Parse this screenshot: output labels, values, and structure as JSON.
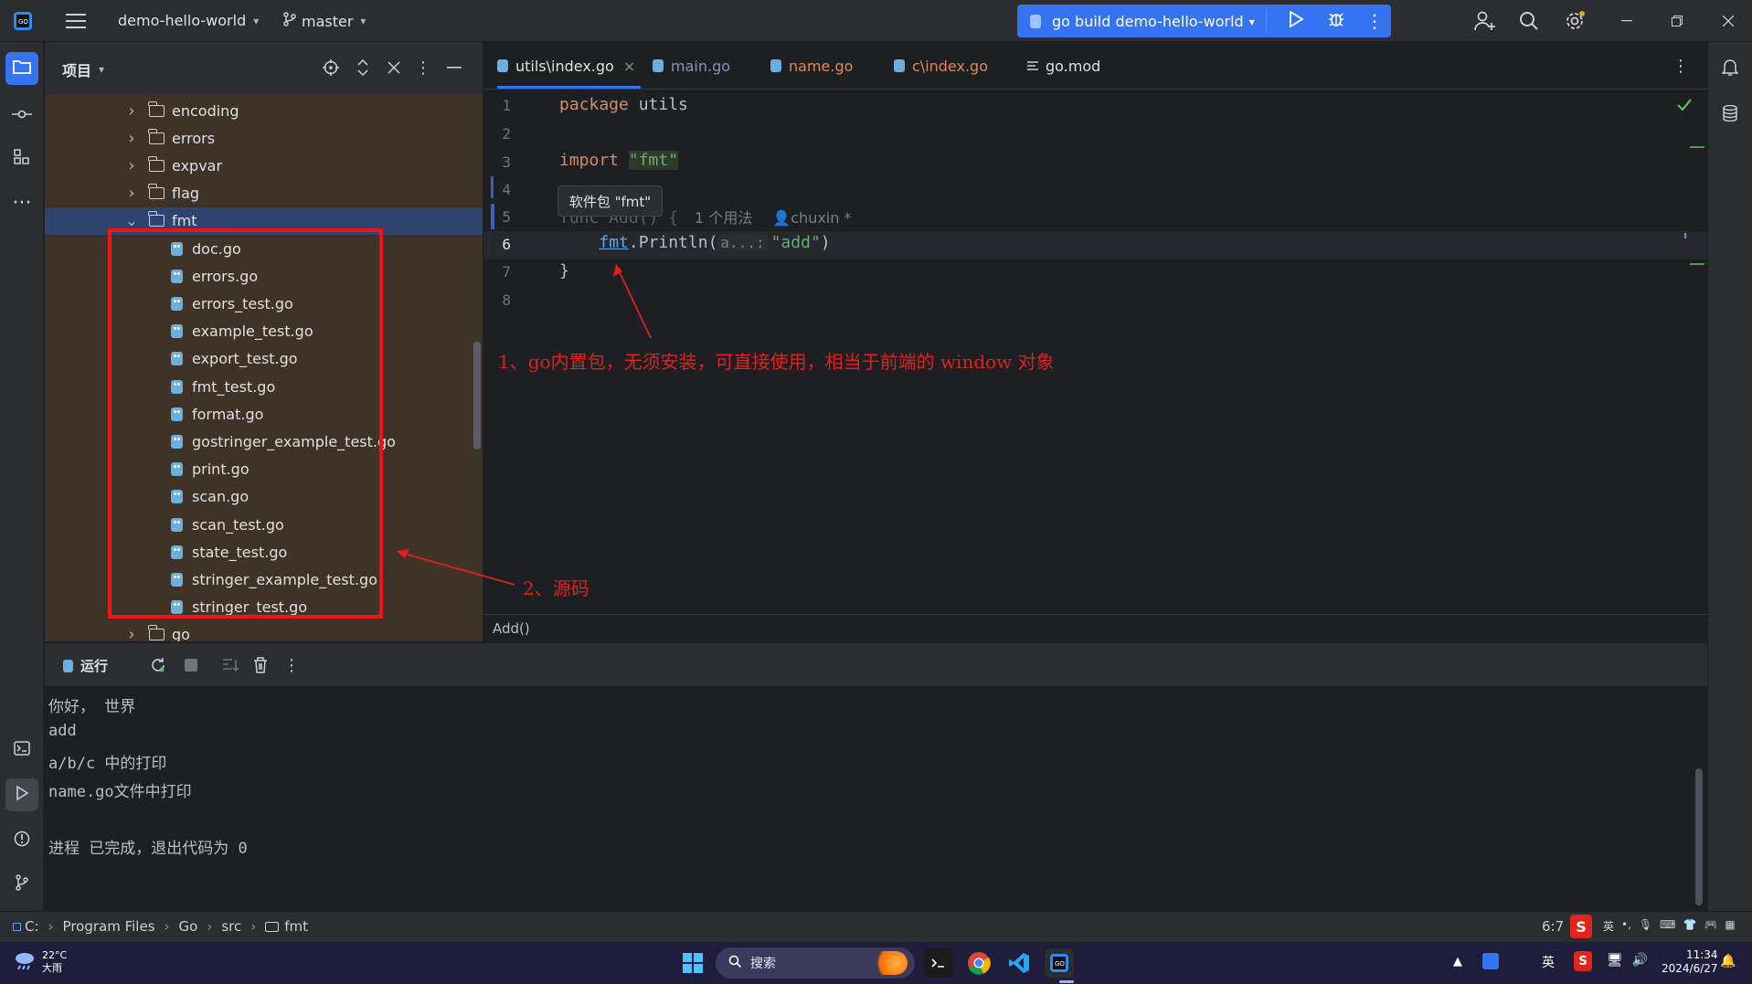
{
  "titlebar": {
    "project_name": "demo-hello-world",
    "branch": "master",
    "run_config": "go build demo-hello-world"
  },
  "project_panel": {
    "title": "项目",
    "tree": [
      {
        "label": "encoding",
        "type": "folder",
        "expanded": false
      },
      {
        "label": "errors",
        "type": "folder",
        "expanded": false
      },
      {
        "label": "expvar",
        "type": "folder",
        "expanded": false
      },
      {
        "label": "flag",
        "type": "folder",
        "expanded": false
      },
      {
        "label": "fmt",
        "type": "folder",
        "expanded": true,
        "selected": true
      },
      {
        "label": "doc.go",
        "type": "file"
      },
      {
        "label": "errors.go",
        "type": "file"
      },
      {
        "label": "errors_test.go",
        "type": "file"
      },
      {
        "label": "example_test.go",
        "type": "file"
      },
      {
        "label": "export_test.go",
        "type": "file"
      },
      {
        "label": "fmt_test.go",
        "type": "file"
      },
      {
        "label": "format.go",
        "type": "file"
      },
      {
        "label": "gostringer_example_test.go",
        "type": "file"
      },
      {
        "label": "print.go",
        "type": "file"
      },
      {
        "label": "scan.go",
        "type": "file"
      },
      {
        "label": "scan_test.go",
        "type": "file"
      },
      {
        "label": "state_test.go",
        "type": "file"
      },
      {
        "label": "stringer_example_test.go",
        "type": "file"
      },
      {
        "label": "stringer_test.go",
        "type": "file"
      },
      {
        "label": "go",
        "type": "folder",
        "expanded": false
      }
    ]
  },
  "tabs": [
    {
      "label": "utils\\index.go",
      "active": true,
      "close": "×"
    },
    {
      "label": "main.go",
      "active": false
    },
    {
      "label": "name.go",
      "active": false
    },
    {
      "label": "c\\index.go",
      "active": false
    },
    {
      "label": "go.mod",
      "active": false
    }
  ],
  "editor": {
    "line_numbers": [
      "1",
      "2",
      "3",
      "4",
      "5",
      "6",
      "7",
      "8"
    ],
    "line1_kw": "package",
    "line1_rest": " utils",
    "line3_kw": "import",
    "line3_str": "\"fmt\"",
    "line5_code": "func Add() {",
    "line5_usages": "1 个用法",
    "line5_author": "chuxin *",
    "line6_pkg": "fmt",
    "line6_call": ".Println(",
    "line6_param_hint": "a...:",
    "line6_str": "\"add\"",
    "line6_close": ")",
    "line7": "}",
    "tooltip": "软件包 \"fmt\"",
    "function_breadcrumb": "Add()"
  },
  "annotations": {
    "note1": "1、go内置包，无须安装，可直接使用，相当于前端的 window 对象",
    "note2": "2、源码"
  },
  "run_panel": {
    "title": "运行",
    "output": [
      "你好， 世界",
      "add",
      "a/b/c 中的打印",
      "name.go文件中打印",
      "",
      "进程 已完成，退出代码为 0"
    ]
  },
  "statusbar": {
    "path": [
      "C:",
      "Program Files",
      "Go",
      "src",
      "fmt"
    ],
    "cursor": "6:7"
  },
  "taskbar": {
    "weather_temp": "22°C",
    "weather_desc": "大雨",
    "search_placeholder": "搜索",
    "ime_lang": "英",
    "time": "11:34",
    "date": "2024/6/27"
  },
  "colors": {
    "accent": "#3574f0",
    "annotation_red": "#e0201f",
    "tree_bg": "#3e3326"
  }
}
